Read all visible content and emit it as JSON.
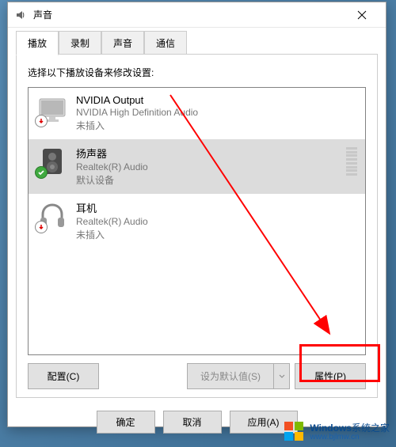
{
  "window": {
    "title": "声音"
  },
  "tabs": [
    {
      "label": "播放"
    },
    {
      "label": "录制"
    },
    {
      "label": "声音"
    },
    {
      "label": "通信"
    }
  ],
  "activeTab": 0,
  "instruction": "选择以下播放设备来修改设置:",
  "devices": [
    {
      "name": "NVIDIA Output",
      "sub": "NVIDIA High Definition Audio",
      "status": "未插入",
      "icon": "monitor",
      "badge": "down",
      "selected": false,
      "showLevel": false
    },
    {
      "name": "扬声器",
      "sub": "Realtek(R) Audio",
      "status": "默认设备",
      "icon": "speaker",
      "badge": "check",
      "selected": true,
      "showLevel": true
    },
    {
      "name": "耳机",
      "sub": "Realtek(R) Audio",
      "status": "未插入",
      "icon": "headphones",
      "badge": "down",
      "selected": false,
      "showLevel": false
    }
  ],
  "buttons": {
    "configure": "配置(C)",
    "setDefault": "设为默认值(S)",
    "properties": "属性(P)",
    "ok": "确定",
    "cancel": "取消",
    "apply": "应用(A)"
  },
  "watermark": {
    "brand": "Windows",
    "suffix": "系统之家",
    "url": "www.bjlmw.cn"
  }
}
